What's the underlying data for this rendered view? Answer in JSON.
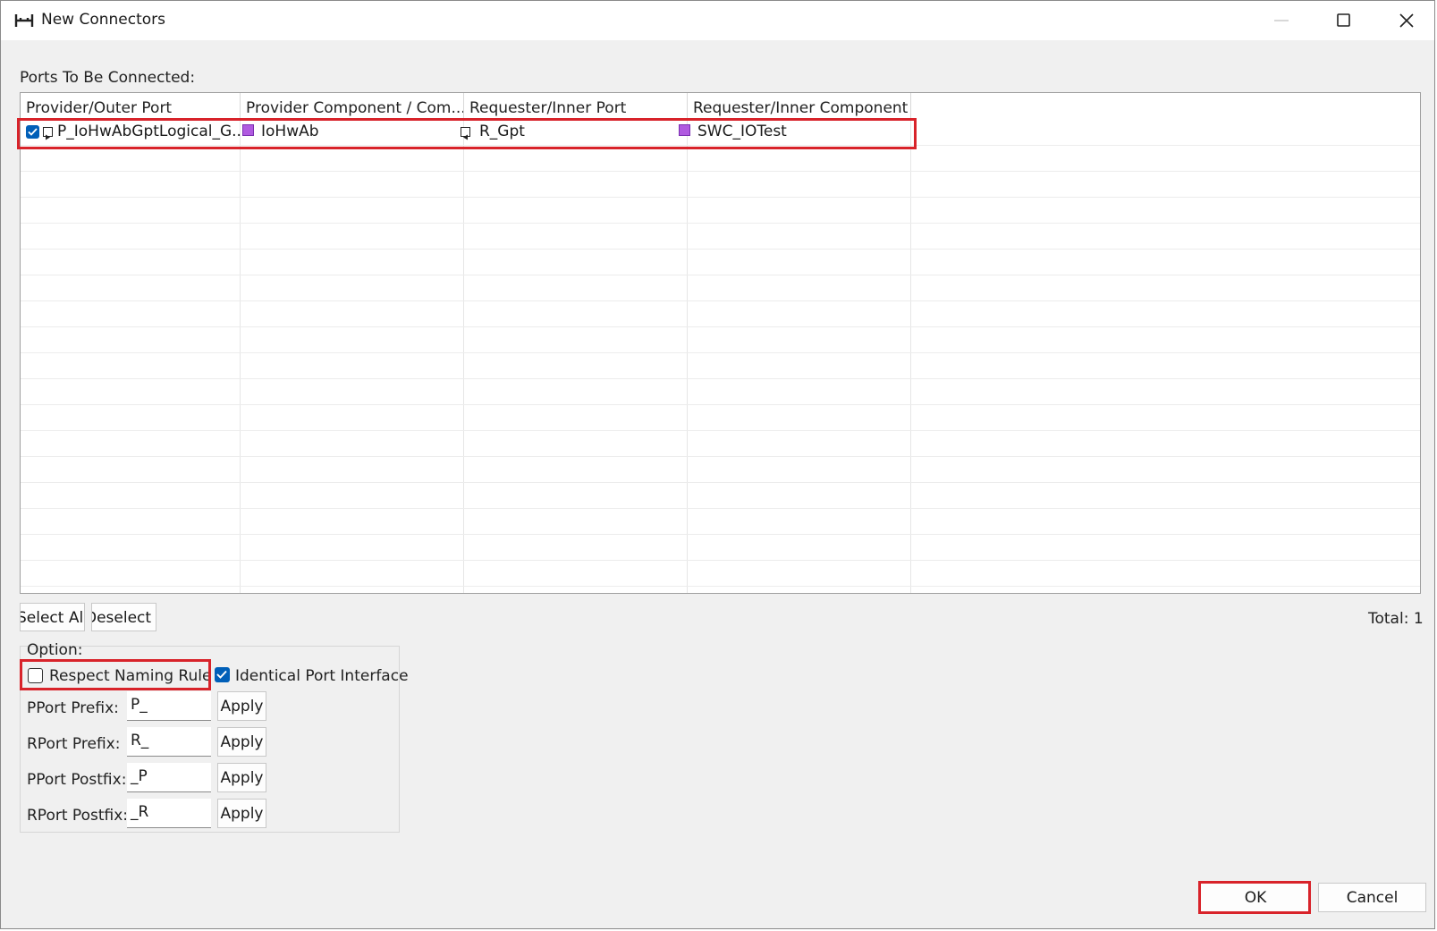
{
  "window": {
    "title": "New Connectors",
    "icon": "connector-icon",
    "controls": [
      "minimize-icon",
      "maximize-icon",
      "close-icon"
    ]
  },
  "ports_label": "Ports To Be Connected:",
  "table": {
    "columns": [
      "Provider/Outer Port",
      "Provider Component / Com...",
      "Requester/Inner Port",
      "Requester/Inner Component"
    ],
    "rows": [
      {
        "checked": true,
        "provider_port": "P_IoHwAbGptLogical_G...",
        "provider_component": "IoHwAb",
        "requester_port": "R_Gpt",
        "requester_component": "SWC_IOTest"
      }
    ]
  },
  "buttons": {
    "select_all": "Select All",
    "deselect_all": "Deselect All",
    "ok": "OK",
    "cancel": "Cancel"
  },
  "total_label": "Total: 1",
  "options": {
    "group_label": "Option:",
    "respect_naming_rule": {
      "label": "Respect Naming Rule",
      "checked": false
    },
    "identical_port_interface": {
      "label": "Identical Port Interface",
      "checked": true
    },
    "fields": [
      {
        "label": "PPort Prefix:",
        "value": "P_",
        "apply": "Apply"
      },
      {
        "label": "RPort Prefix:",
        "value": "R_",
        "apply": "Apply"
      },
      {
        "label": "PPort Postfix:",
        "value": "_P",
        "apply": "Apply"
      },
      {
        "label": "RPort Postfix:",
        "value": "_R",
        "apply": "Apply"
      }
    ]
  },
  "colors": {
    "highlight": "#d8232a",
    "checkbox_accent": "#005fb8",
    "component_icon": "#b05ae0"
  }
}
